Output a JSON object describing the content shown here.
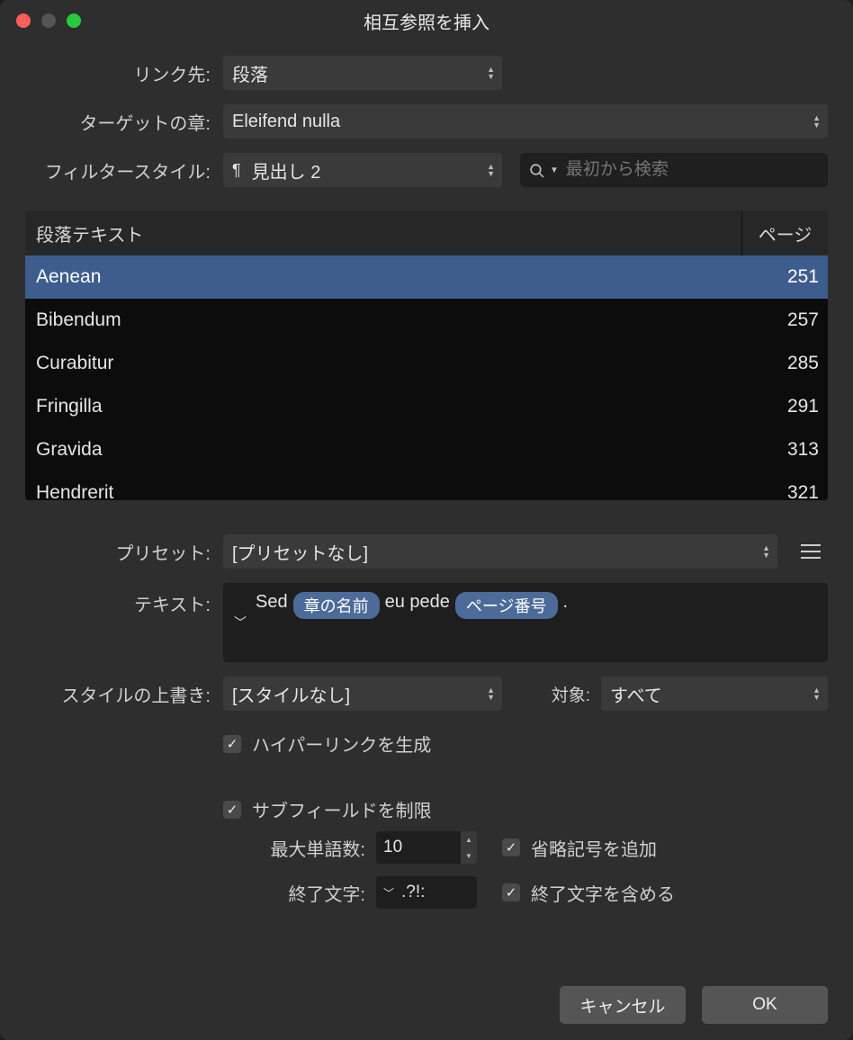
{
  "title": "相互参照を挿入",
  "linkTo": {
    "label": "リンク先:",
    "value": "段落"
  },
  "targetChapter": {
    "label": "ターゲットの章:",
    "value": "Eleifend nulla"
  },
  "filterStyle": {
    "label": "フィルタースタイル:",
    "value": "見出し 2"
  },
  "search": {
    "placeholder": "最初から検索"
  },
  "table": {
    "headers": {
      "text": "段落テキスト",
      "page": "ページ"
    },
    "rows": [
      {
        "text": "Aenean",
        "page": "251",
        "selected": true
      },
      {
        "text": "Bibendum",
        "page": "257"
      },
      {
        "text": "Curabitur",
        "page": "285"
      },
      {
        "text": "Fringilla",
        "page": "291"
      },
      {
        "text": "Gravida",
        "page": "313"
      },
      {
        "text": "Hendrerit",
        "page": "321"
      }
    ]
  },
  "preset": {
    "label": "プリセット:",
    "value": "[プリセットなし]"
  },
  "textRow": {
    "label": "テキスト:",
    "parts": {
      "p0": "Sed",
      "pill1": "章の名前",
      "p1": "eu pede",
      "pill2": "ページ番号",
      "p2": "."
    }
  },
  "styleOverride": {
    "label": "スタイルの上書き:",
    "value": "[スタイルなし]"
  },
  "applyTo": {
    "label": "対象:",
    "value": "すべて"
  },
  "hyperlink": "ハイパーリンクを生成",
  "limitSub": "サブフィールドを制限",
  "maxWords": {
    "label": "最大単語数:",
    "value": "10"
  },
  "addEllipsis": "省略記号を追加",
  "termChars": {
    "label": "終了文字:",
    "value": ".?!:"
  },
  "includeTerm": "終了文字を含める",
  "buttons": {
    "cancel": "キャンセル",
    "ok": "OK"
  }
}
